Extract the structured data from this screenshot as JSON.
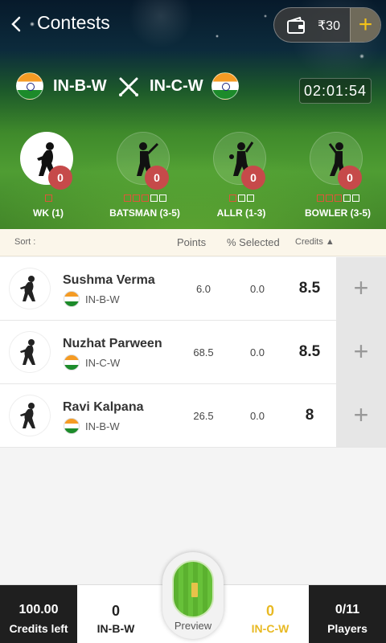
{
  "header": {
    "title": "Contests",
    "wallet_amount": "₹30",
    "wallet_add": "+"
  },
  "match": {
    "team1": "IN-B-W",
    "team2": "IN-C-W",
    "timer": "02:01:54"
  },
  "roles": [
    {
      "label": "WK (1)",
      "count": "0",
      "boxes": 1,
      "active": true
    },
    {
      "label": "BATSMAN (3-5)",
      "count": "0",
      "boxes": 5,
      "required": 3,
      "active": false
    },
    {
      "label": "ALLR (1-3)",
      "count": "0",
      "boxes": 3,
      "required": 1,
      "active": false
    },
    {
      "label": "BOWLER (3-5)",
      "count": "0",
      "boxes": 5,
      "required": 3,
      "active": false
    }
  ],
  "sort": {
    "label": "Sort :",
    "columns": {
      "points": "Points",
      "selected": "% Selected",
      "credits": "Credits ▲"
    }
  },
  "players": [
    {
      "name": "Sushma Verma",
      "team": "IN-B-W",
      "points": "6.0",
      "selected": "0.0",
      "credits": "8.5"
    },
    {
      "name": "Nuzhat Parween",
      "team": "IN-C-W",
      "points": "68.5",
      "selected": "0.0",
      "credits": "8.5"
    },
    {
      "name": "Ravi Kalpana",
      "team": "IN-B-W",
      "points": "26.5",
      "selected": "0.0",
      "credits": "8"
    }
  ],
  "bottom": {
    "credits_value": "100.00",
    "credits_label": "Credits left",
    "team1_count": "0",
    "team1_name": "IN-B-W",
    "preview_label": "Preview",
    "team2_count": "0",
    "team2_name": "IN-C-W",
    "players_value": "0/11",
    "players_label": "Players"
  },
  "colors": {
    "accent_yellow": "#f3c218",
    "badge_red": "#c64a4a",
    "dark": "#1f1f1f",
    "team2_text": "#e8b923"
  },
  "icons": {
    "back": "chevron-left-icon",
    "wallet": "wallet-icon",
    "vs": "crossed-bats-icon",
    "wk": "wicket-keeper-icon",
    "bat": "batsman-icon",
    "allr": "all-rounder-icon",
    "bowl": "bowler-icon",
    "add": "plus-icon"
  }
}
